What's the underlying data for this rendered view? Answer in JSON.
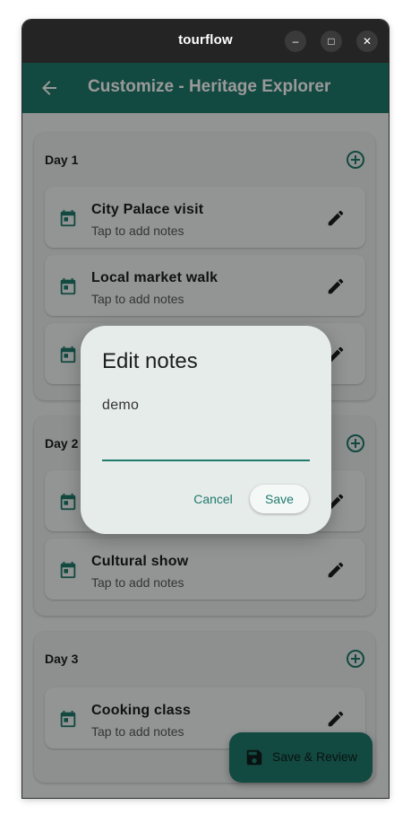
{
  "window": {
    "title": "tourflow",
    "minimize": "–",
    "maximize": "□",
    "close": "✕"
  },
  "appbar": {
    "title": "Customize - Heritage Explorer",
    "back_icon": "arrow-left-icon"
  },
  "colors": {
    "primary": "#1f7a6c",
    "titlebar": "#242424",
    "scrim": "rgba(0,0,0,0.40)"
  },
  "days": [
    {
      "label": "Day 1",
      "items": [
        {
          "title": "City Palace visit",
          "note": "Tap to add notes"
        },
        {
          "title": "Local market walk",
          "note": "Tap to add notes"
        },
        {
          "title": "",
          "note": ""
        }
      ]
    },
    {
      "label": "Day 2",
      "items": [
        {
          "title": "",
          "note": ""
        },
        {
          "title": "Cultural show",
          "note": "Tap to add notes"
        }
      ]
    },
    {
      "label": "Day 3",
      "items": [
        {
          "title": "Cooking class",
          "note": "Tap to add notes"
        }
      ]
    }
  ],
  "fab": {
    "label": "Save & Review",
    "icon": "save-icon"
  },
  "dialog": {
    "title": "Edit notes",
    "value": "demo",
    "cancel_label": "Cancel",
    "save_label": "Save"
  }
}
